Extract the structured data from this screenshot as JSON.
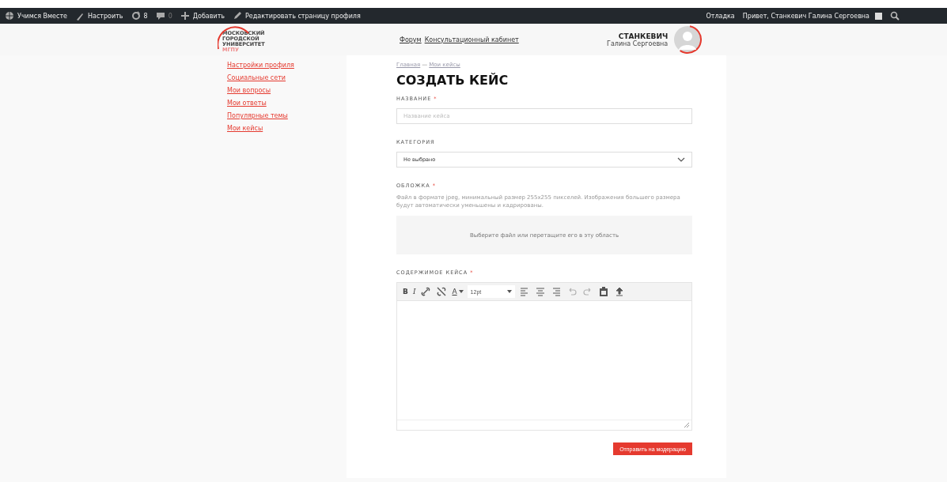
{
  "admin_bar": {
    "left": [
      {
        "kind": "site",
        "label": "Учимся Вместе"
      },
      {
        "kind": "customize",
        "label": "Настроить"
      },
      {
        "kind": "updates",
        "label": "8"
      },
      {
        "kind": "comments",
        "label": "0"
      },
      {
        "kind": "add",
        "label": "Добавить"
      },
      {
        "kind": "edit",
        "label": "Редактировать страницу профиля"
      }
    ],
    "right": [
      {
        "kind": "text",
        "label": "Отладка"
      },
      {
        "kind": "greeting",
        "label": "Привет, Станкевич Галина Сергоевна"
      },
      {
        "kind": "search"
      }
    ]
  },
  "header": {
    "logo_lines": [
      "МОСКОВСКИЙ",
      "ГОРОДСКОЙ",
      "УНИВЕРСИТЕТ",
      "МГПУ"
    ],
    "nav": [
      "Форум",
      "Консультационный кабинет"
    ],
    "user": {
      "surname": "СТАНКЕВИЧ",
      "name": "Галина Сергоевна"
    }
  },
  "sidebar": {
    "items": [
      {
        "label": "Настройки профиля",
        "selected": false
      },
      {
        "label": "Социальные сети",
        "selected": false
      },
      {
        "label": "Мои вопросы",
        "selected": false
      },
      {
        "label": "Мои ответы",
        "selected": false
      },
      {
        "label": "Популярные темы",
        "selected": false
      },
      {
        "label": "Мои кейсы",
        "selected": false
      }
    ]
  },
  "breadcrumb": [
    "Главная",
    "Мои кейсы"
  ],
  "breadcrumb_separator": "—",
  "title": "СОЗДАТЬ КЕЙС",
  "form": [
    {
      "kind": "text",
      "label": "НАЗВАНИЕ",
      "required": true,
      "placeholder": "Название кейса"
    },
    {
      "kind": "select",
      "label": "КАТЕГОРИЯ",
      "required": false,
      "value": "Не выбрано"
    },
    {
      "kind": "upload",
      "label": "ОБЛОЖКА",
      "required": true,
      "hint": "Файл в формате jpeg, минимальный размер 255x255 пикселей. Изображения большего размера будут автоматически уменьшены и кадрированы.",
      "dropzone": "Выберите файл или перетащите его в эту область"
    },
    {
      "kind": "editor",
      "label": "СОДЕРЖИМОЕ КЕЙСА",
      "required": true,
      "toolbar": [
        {
          "kind": "bold",
          "label": "B",
          "disabled": false
        },
        {
          "kind": "italic",
          "label": "I",
          "disabled": false
        },
        {
          "kind": "link",
          "disabled": false
        },
        {
          "kind": "unlink",
          "disabled": false
        },
        {
          "kind": "color",
          "label": "A",
          "disabled": false
        },
        {
          "kind": "size",
          "label": "12pt"
        },
        {
          "kind": "align-left",
          "disabled": false
        },
        {
          "kind": "align-center",
          "disabled": false
        },
        {
          "kind": "align-right",
          "disabled": false
        },
        {
          "kind": "undo",
          "disabled": true
        },
        {
          "kind": "redo",
          "disabled": true
        },
        {
          "kind": "paste",
          "disabled": false
        },
        {
          "kind": "upload",
          "disabled": false
        }
      ]
    }
  ],
  "required_mark": "*",
  "submit": "Отправить на модерацию"
}
